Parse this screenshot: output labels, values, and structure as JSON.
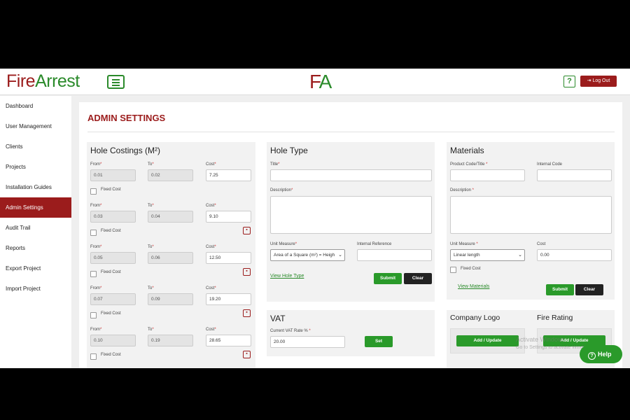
{
  "header": {
    "brand_prefix": "F",
    "brand_mid": "i",
    "brand_r": "re",
    "brand_rest": "Arrest",
    "center_logo_f": "F",
    "center_logo_a": "A",
    "help_icon_text": "?",
    "logout_label": "Log Out",
    "logout_icon": "logout-icon"
  },
  "sidebar": {
    "items": [
      {
        "label": "Dashboard"
      },
      {
        "label": "User Management"
      },
      {
        "label": "Clients"
      },
      {
        "label": "Projects"
      },
      {
        "label": "Installation Guides"
      },
      {
        "label": "Admin Settings",
        "active": true
      },
      {
        "label": "Audit Trail"
      },
      {
        "label": "Reports"
      },
      {
        "label": "Export Project"
      },
      {
        "label": "Import Project"
      }
    ]
  },
  "page": {
    "title": "ADMIN SETTINGS"
  },
  "hole_costings": {
    "title": "Hole Costings (M²)",
    "from_label": "From",
    "to_label": "To",
    "cost_label": "Cost",
    "fixed_cost_label": "Fixed Cost",
    "rows": [
      {
        "from": "0.01",
        "to": "0.02",
        "cost": "7.25"
      },
      {
        "from": "0.03",
        "to": "0.04",
        "cost": "9.10"
      },
      {
        "from": "0.05",
        "to": "0.06",
        "cost": "12.50"
      },
      {
        "from": "0.07",
        "to": "0.09",
        "cost": "19.20"
      },
      {
        "from": "0.10",
        "to": "0.19",
        "cost": "28.65"
      }
    ]
  },
  "hole_type": {
    "title": "Hole Type",
    "title_label": "Title",
    "description_label": "Description",
    "unit_measure_label": "Unit Measure",
    "unit_measure_value": "Area of a Square (m²) = Heigh",
    "internal_ref_label": "Internal Reference",
    "view_link": "View Hole Type",
    "submit": "Submit",
    "clear": "Clear"
  },
  "materials": {
    "title": "Materials",
    "product_code_label": "Product Code/Title",
    "internal_code_label": "Internal Code",
    "description_label": "Description",
    "unit_measure_label": "Unit Measure",
    "unit_measure_value": "Linear length",
    "cost_label": "Cost",
    "cost_value": "0.00",
    "fixed_cost_label": "Fixed Cost",
    "view_link": "View Materials",
    "submit": "Submit",
    "clear": "Clear"
  },
  "vat": {
    "title": "VAT",
    "rate_label": "Current VAT Rate %",
    "rate_value": "20.00",
    "set": "Set"
  },
  "company_logo": {
    "title": "Company Logo",
    "button": "Add / Update"
  },
  "fire_rating": {
    "title": "Fire Rating",
    "button": "Add / Update"
  },
  "overlay": {
    "watermark_line1": "Activate Windows",
    "watermark_line2": "Go to Settings to activate Windows."
  },
  "help": {
    "label": "Help",
    "icon_text": "?"
  },
  "colors": {
    "brand_red": "#9b1c1c",
    "brand_green": "#2a8a2a"
  }
}
